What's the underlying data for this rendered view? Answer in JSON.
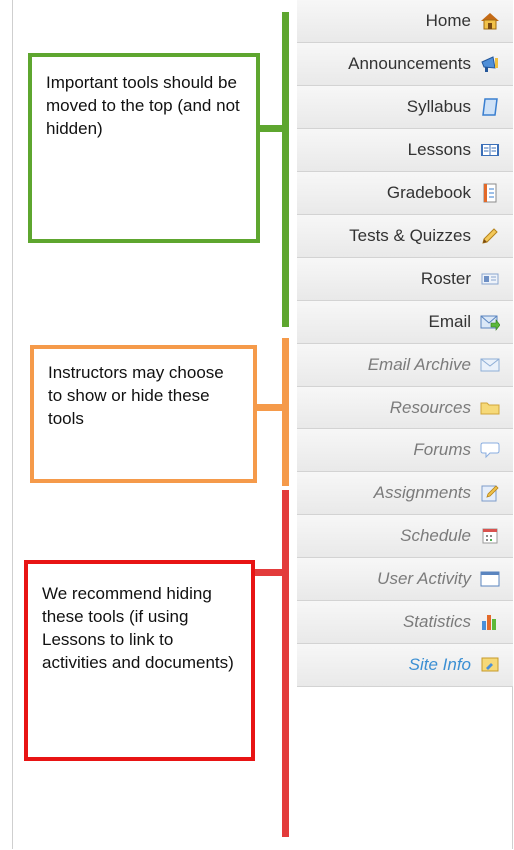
{
  "menu": {
    "items": [
      {
        "label": "Home",
        "icon": "home-icon",
        "style": "normal"
      },
      {
        "label": "Announcements",
        "icon": "announcements-icon",
        "style": "normal"
      },
      {
        "label": "Syllabus",
        "icon": "syllabus-icon",
        "style": "normal"
      },
      {
        "label": "Lessons",
        "icon": "lessons-icon",
        "style": "normal"
      },
      {
        "label": "Gradebook",
        "icon": "gradebook-icon",
        "style": "normal"
      },
      {
        "label": "Tests & Quizzes",
        "icon": "pencil-icon",
        "style": "normal"
      },
      {
        "label": "Roster",
        "icon": "roster-icon",
        "style": "normal"
      },
      {
        "label": "Email",
        "icon": "email-icon",
        "style": "normal"
      },
      {
        "label": "Email Archive",
        "icon": "email-archive-icon",
        "style": "hidden"
      },
      {
        "label": "Resources",
        "icon": "folder-icon",
        "style": "hidden"
      },
      {
        "label": "Forums",
        "icon": "forums-icon",
        "style": "hidden"
      },
      {
        "label": "Assignments",
        "icon": "assignments-icon",
        "style": "hidden"
      },
      {
        "label": "Schedule",
        "icon": "calendar-icon",
        "style": "hidden"
      },
      {
        "label": "User Activity",
        "icon": "window-icon",
        "style": "hidden"
      },
      {
        "label": "Statistics",
        "icon": "bar-chart-icon",
        "style": "hidden"
      },
      {
        "label": "Site Info",
        "icon": "site-info-icon",
        "style": "siteinfo"
      }
    ]
  },
  "annotations": {
    "important": {
      "text": "Important tools should be moved to the top (and not hidden)",
      "color": "#5ea62f"
    },
    "optional": {
      "text": "Instructors may choose to show or hide these tools",
      "color": "#f59a4a"
    },
    "hide": {
      "text": "We recommend hiding these tools (if using Lessons to link to activities and documents)",
      "color": "#e33b3b"
    }
  },
  "colors": {
    "green": "#5ea62f",
    "orange": "#f59a4a",
    "red": "#e33b3b",
    "siteinfo_text": "#3b8fd3"
  }
}
